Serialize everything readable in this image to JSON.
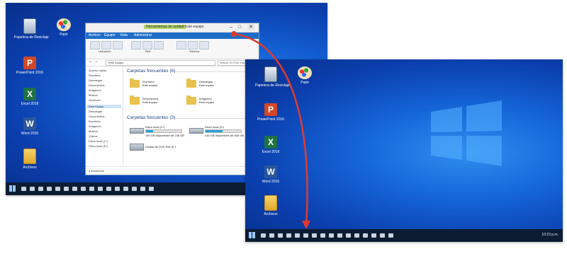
{
  "screenshot_left": {
    "desktop_icons": [
      {
        "label": "Papelera de Reciclaje",
        "icon": "recycle-bin-icon"
      },
      {
        "label": "Paint",
        "icon": "paint-palette-icon"
      },
      {
        "label": "PowerPoint 2016",
        "icon": "powerpoint-icon"
      },
      {
        "label": "Excel 2016",
        "icon": "excel-icon"
      },
      {
        "label": "Word 2016",
        "icon": "word-icon"
      },
      {
        "label": "Archivos",
        "icon": "folder-icon"
      }
    ],
    "explorer": {
      "title_highlight": "Herramientas de unidad",
      "title": "Este equipo",
      "ribbon_tabs": [
        "Archivo",
        "Equipo",
        "Vista",
        "Administrar"
      ],
      "ribbon_groups": [
        "Ubicación",
        "Red",
        "Sistema"
      ],
      "address": "Este equipo",
      "search_placeholder": "Buscar en Este equipo",
      "nav_items": [
        "Acceso rápido",
        "Escritorio",
        "Descargas",
        "Documentos",
        "Imágenes",
        "Música",
        "OneDrive",
        "Este equipo",
        "Descargas",
        "Documentos",
        "Escritorio",
        "Imágenes",
        "Música",
        "Vídeos",
        "Disco local (C:)",
        "Disco local (D:)"
      ],
      "group_folders": "Carpetas frecuentes (6)",
      "folders": [
        {
          "name": "Escritorio\nEste equipo"
        },
        {
          "name": "Descargas\nEste equipo"
        },
        {
          "name": "Documentos\nEste equipo"
        },
        {
          "name": "Imágenes\nEste equipo"
        }
      ],
      "group_drives": "Carpetas frecuentes (3)",
      "drives": [
        {
          "name": "Disco local (C:)",
          "detail": "190 GB disponibles de 236 GB",
          "used": 0.2
        },
        {
          "name": "Disco local (D:)",
          "detail": "245 GB disponibles de 465 GB",
          "used": 0.47
        },
        {
          "name": "Unidad de DVD RW (E:)",
          "detail": ""
        }
      ],
      "status": "9 elementos"
    },
    "taskbar_time": ""
  },
  "screenshot_right": {
    "desktop_icons": [
      {
        "label": "Papelera de Reciclaje",
        "icon": "recycle-bin-icon"
      },
      {
        "label": "Paint",
        "icon": "paint-palette-icon"
      },
      {
        "label": "PowerPoint 2016",
        "icon": "powerpoint-icon"
      },
      {
        "label": "Excel 2016",
        "icon": "excel-icon"
      },
      {
        "label": "Word 2016",
        "icon": "word-icon"
      },
      {
        "label": "Archivos",
        "icon": "folder-icon"
      }
    ],
    "taskbar_time": "10:23 p.m."
  },
  "annotation": {
    "color": "#e23a2e",
    "target": "close-button"
  },
  "colors": {
    "desktop": "#1565d8",
    "taskbar": "#0c1c33",
    "ribbon_tab": "#1d6ec8",
    "arrow": "#e23a2e"
  }
}
